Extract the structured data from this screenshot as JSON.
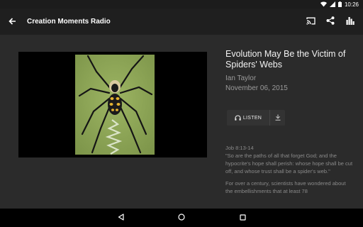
{
  "status_bar": {
    "time": "10:26",
    "icons": [
      "wifi-icon",
      "signal-icon",
      "battery-icon"
    ]
  },
  "app_bar": {
    "title": "Creation Moments Radio",
    "back_icon": "arrow-back-icon",
    "actions": [
      "cast-icon",
      "share-icon",
      "equalizer-icon"
    ]
  },
  "episode": {
    "title": "Evolution May Be the Victim of Spiders' Webs",
    "author": "Ian Taylor",
    "date": "November 06, 2015",
    "listen_label": "LISTEN",
    "scripture_ref": "Job 8:13-14",
    "scripture_text": "\"So are the paths of all that forget God; and the hypocrite's hope shall perish: whose hope shall be cut off, and whose trust shall be a spider's web.\"",
    "body_intro": "For over a century, scientists have wondered about the embellishments that at least 78"
  },
  "nav_bar": {
    "icons": [
      "back-triangle-icon",
      "home-circle-icon",
      "recents-square-icon"
    ]
  },
  "colors": {
    "background": "#2b2b2b",
    "app_bar": "#1f1f1f",
    "nav_bar": "#000000"
  }
}
